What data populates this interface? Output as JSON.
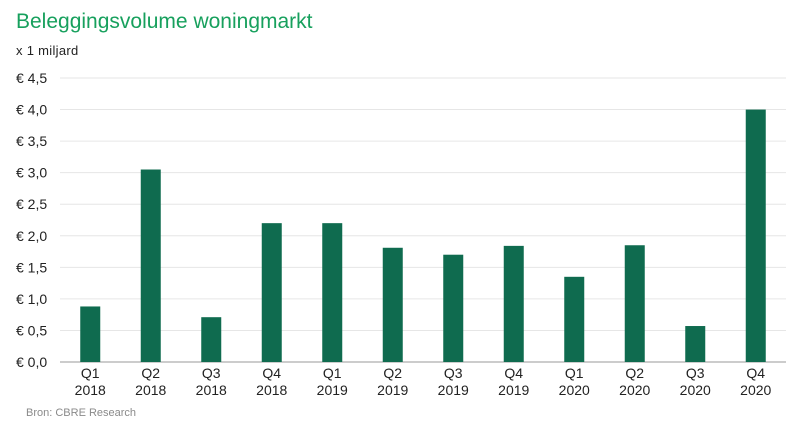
{
  "header": {
    "title": "Beleggingsvolume woningmarkt",
    "subtitle": "x 1 miljard"
  },
  "footer": {
    "source": "Bron: CBRE Research"
  },
  "colors": {
    "bar": "#0f6b4f",
    "title": "#17a05d",
    "grid": "#e6e6e6",
    "axis": "#9a9a9a"
  },
  "chart_data": {
    "type": "bar",
    "title": "Beleggingsvolume woningmarkt",
    "ylabel": "x 1 miljard",
    "xlabel": "",
    "ylim": [
      0,
      4.5
    ],
    "grid": true,
    "yticks": [
      0,
      0.5,
      1.0,
      1.5,
      2.0,
      2.5,
      3.0,
      3.5,
      4.0,
      4.5
    ],
    "ytick_labels": [
      "€ 0,0",
      "€ 0,5",
      "€ 1,0",
      "€ 1,5",
      "€ 2,0",
      "€ 2,5",
      "€ 3,0",
      "€ 3,5",
      "€ 4,0",
      "€ 4,5"
    ],
    "categories": [
      {
        "quarter": "Q1",
        "year": "2018"
      },
      {
        "quarter": "Q2",
        "year": "2018"
      },
      {
        "quarter": "Q3",
        "year": "2018"
      },
      {
        "quarter": "Q4",
        "year": "2018"
      },
      {
        "quarter": "Q1",
        "year": "2019"
      },
      {
        "quarter": "Q2",
        "year": "2019"
      },
      {
        "quarter": "Q3",
        "year": "2019"
      },
      {
        "quarter": "Q4",
        "year": "2019"
      },
      {
        "quarter": "Q1",
        "year": "2020"
      },
      {
        "quarter": "Q2",
        "year": "2020"
      },
      {
        "quarter": "Q3",
        "year": "2020"
      },
      {
        "quarter": "Q4",
        "year": "2020"
      }
    ],
    "values": [
      0.88,
      3.05,
      0.71,
      2.2,
      2.2,
      1.81,
      1.7,
      1.84,
      1.35,
      1.85,
      0.57,
      4.0
    ]
  }
}
